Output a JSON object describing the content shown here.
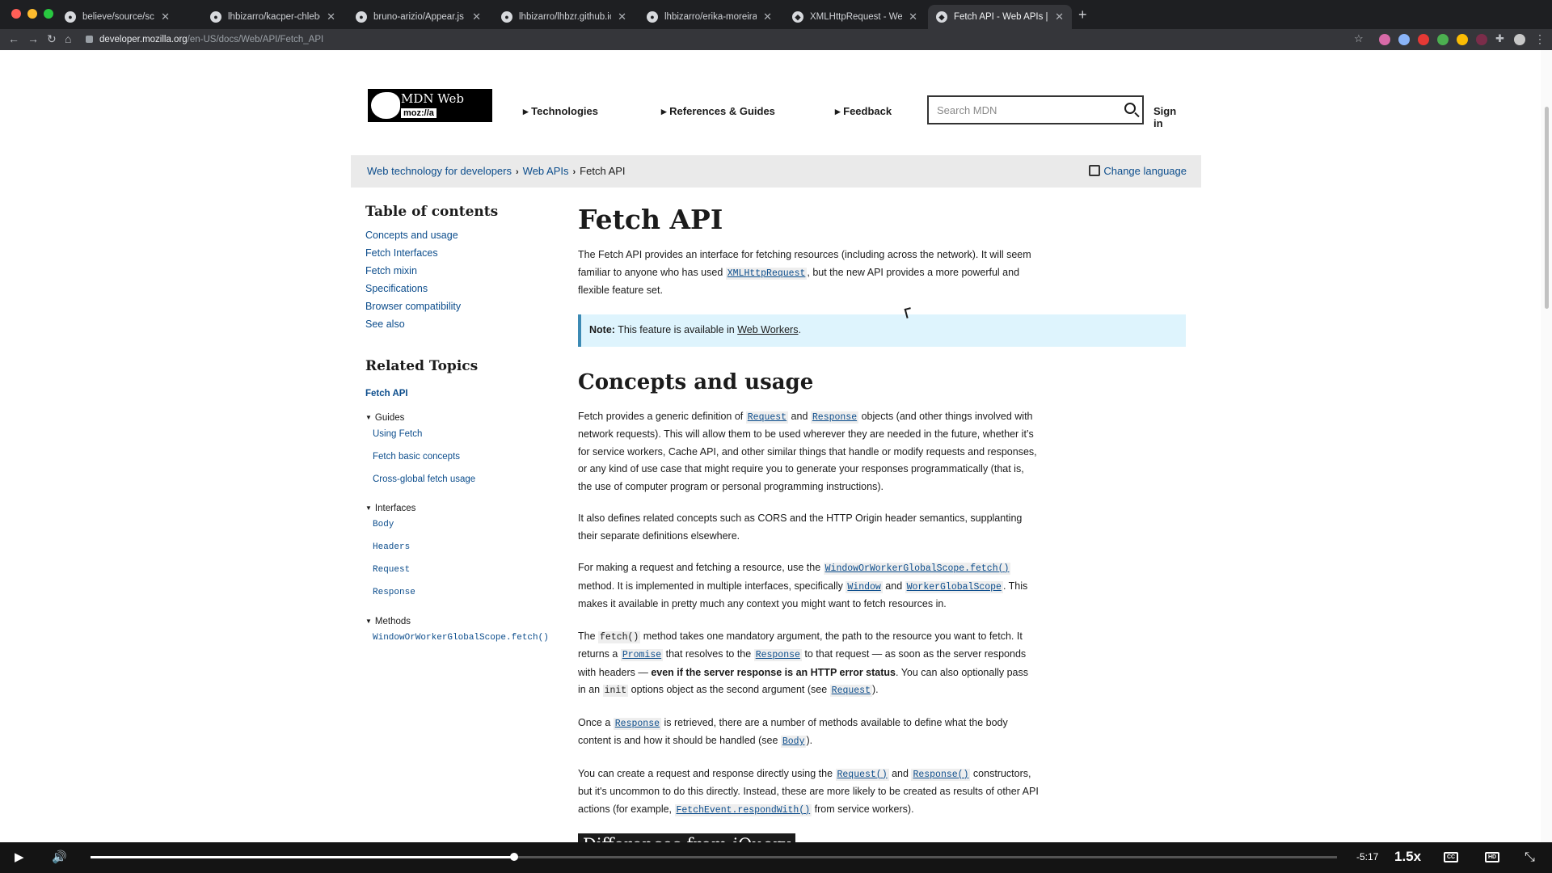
{
  "browser": {
    "tabs": [
      {
        "title": "believe/source/scripts at mast",
        "icon": "github-icon"
      },
      {
        "title": "lhbizarro/kacper-chlebowicz",
        "icon": "github-icon"
      },
      {
        "title": "bruno-arizio/Appear.js at mast",
        "icon": "github-icon"
      },
      {
        "title": "lhbizarro/lhbzr.github.io: Supe",
        "icon": "github-icon"
      },
      {
        "title": "lhbizarro/erika-moreira-portfo",
        "icon": "github-icon"
      },
      {
        "title": "XMLHttpRequest - Web APIs |",
        "icon": "mdn-icon"
      },
      {
        "title": "Fetch API - Web APIs | MDN",
        "icon": "mdn-icon"
      }
    ],
    "address_host": "developer.mozilla.org",
    "address_path": "/en-US/docs/Web/API/Fetch_API"
  },
  "header": {
    "logo_name": "MDN Web Docs",
    "logo_sub": "moz://a",
    "nav": [
      "Technologies",
      "References & Guides",
      "Feedback"
    ],
    "search_placeholder": "Search MDN",
    "signin": "Sign in"
  },
  "breadcrumb": {
    "items": [
      "Web technology for developers",
      "Web APIs",
      "Fetch API"
    ],
    "change_language": "Change language"
  },
  "toc": {
    "title": "Table of contents",
    "items": [
      "Concepts and usage",
      "Fetch Interfaces",
      "Fetch mixin",
      "Specifications",
      "Browser compatibility",
      "See also"
    ]
  },
  "related": {
    "title": "Related Topics",
    "topic": "Fetch API",
    "guides_label": "Guides",
    "guides": [
      "Using Fetch",
      "Fetch basic concepts",
      "Cross-global fetch usage"
    ],
    "interfaces_label": "Interfaces",
    "interfaces": [
      "Body",
      "Headers",
      "Request",
      "Response"
    ],
    "methods_label": "Methods",
    "methods": [
      "WindowOrWorkerGlobalScope.fetch()"
    ]
  },
  "article": {
    "title": "Fetch API",
    "intro_a": "The Fetch API provides an interface for fetching resources (including across the network). It will seem familiar to anyone who has used ",
    "intro_link": "XMLHttpRequest",
    "intro_b": ", but the new API provides a more powerful and flexible feature set.",
    "note_label": "Note:",
    "note_text": " This feature is available in ",
    "note_link": "Web Workers",
    "note_end": ".",
    "h2": "Concepts and usage",
    "p1_a": "Fetch provides a generic definition of ",
    "p1_l1": "Request",
    "p1_b": " and ",
    "p1_l2": "Response",
    "p1_c": " objects (and other things involved with network requests). This will allow them to be used wherever they are needed in the future, whether it’s for service workers, Cache API, and other similar things that handle or modify requests and responses, or any kind of use case that might require you to generate your responses programmatically (that is, the use of computer program or personal programming instructions).",
    "p2": "It also defines related concepts such as CORS and the HTTP Origin header semantics, supplanting their separate definitions elsewhere.",
    "p3_a": "For making a request and fetching a resource, use the ",
    "p3_l1": "WindowOrWorkerGlobalScope.fetch()",
    "p3_b": " method. It is implemented in multiple interfaces, specifically ",
    "p3_l2": "Window",
    "p3_c": " and ",
    "p3_l3": "WorkerGlobalScope",
    "p3_d": ". This makes it available in pretty much any context you might want to fetch resources in.",
    "p4_a": "The ",
    "p4_c1": "fetch()",
    "p4_b": " method takes one mandatory argument, the path to the resource you want to fetch. It returns a ",
    "p4_l1": "Promise",
    "p4_c": " that resolves to the ",
    "p4_l2": "Response",
    "p4_d": " to that request — as soon as the server responds with headers — ",
    "p4_bold": "even if the server response is an HTTP error status",
    "p4_e": ". You can also optionally pass in an ",
    "p4_c2": "init",
    "p4_f": " options object as the second argument (see ",
    "p4_l3": "Request",
    "p4_g": ").",
    "p5_a": "Once a ",
    "p5_l1": "Response",
    "p5_b": " is retrieved, there are a number of methods available to define what the body content is and how it should be handled (see ",
    "p5_l2": "Body",
    "p5_c": ").",
    "p6_a": "You can create a request and response directly using the ",
    "p6_l1": "Request()",
    "p6_b": " and ",
    "p6_l2": "Response()",
    "p6_c": " constructors, but it's uncommon to do this directly. Instead, these are more likely to be created as results of other API actions (for example, ",
    "p6_l3": "FetchEvent.respondWith()",
    "p6_d": " from service workers).",
    "h2_next": "Differences from jQuery"
  },
  "player": {
    "time": "-5:17",
    "rate": "1.5x",
    "progress": 0.34
  },
  "colors": {
    "link": "#0c4d8c",
    "note_bg": "#def4fd",
    "note_border": "#3c8ab4"
  }
}
